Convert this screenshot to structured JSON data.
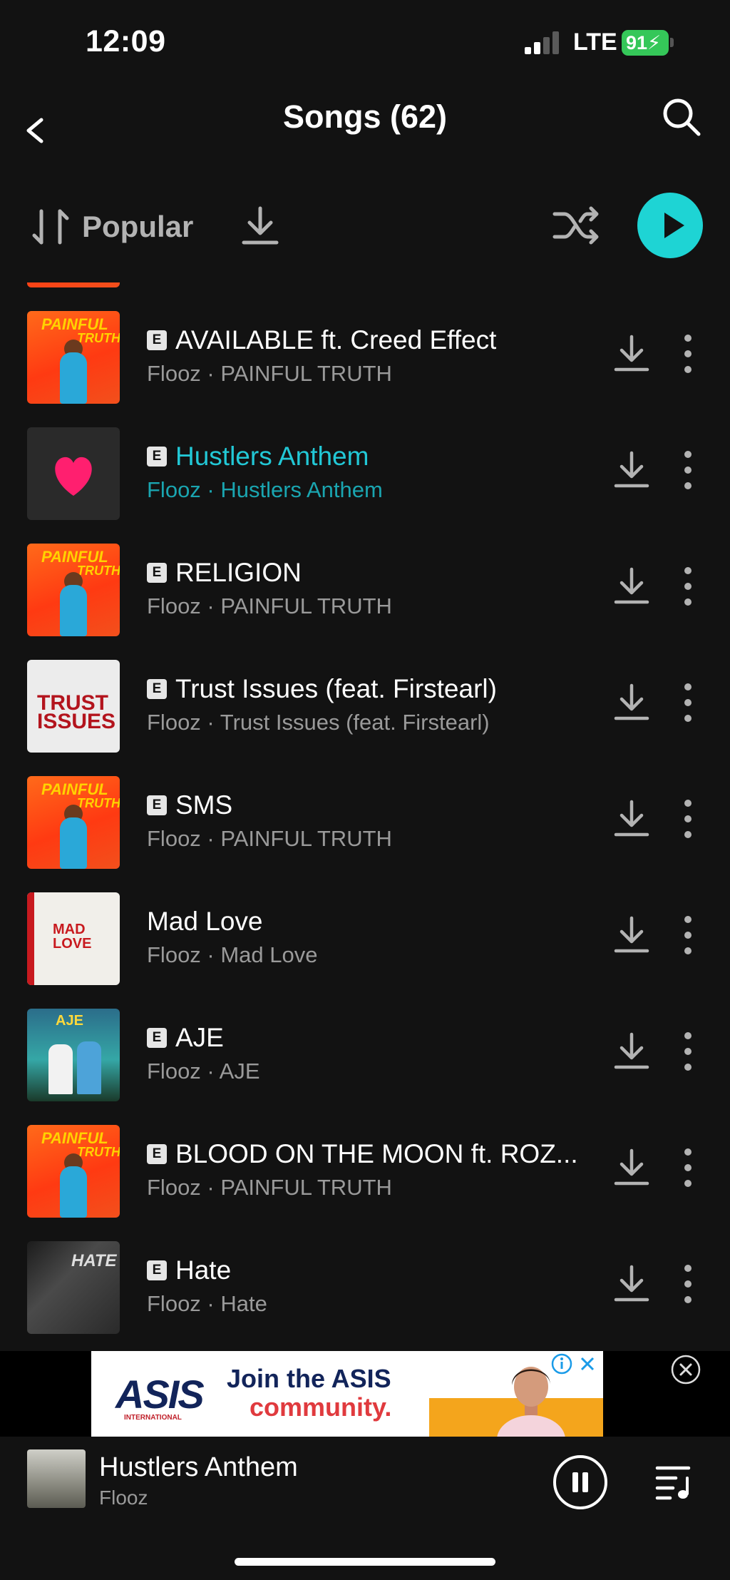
{
  "status": {
    "time": "12:09",
    "network": "LTE",
    "battery": "91"
  },
  "header": {
    "title": "Songs (62)",
    "back_icon": "chevron-left-icon",
    "search_icon": "search-icon"
  },
  "toolbar": {
    "sort_label": "Popular",
    "sort_icon": "sort-icon",
    "download_icon": "download-icon",
    "shuffle_icon": "shuffle-icon",
    "play_icon": "play-icon"
  },
  "colors": {
    "accent": "#1ed4d4",
    "active_text": "#22c8d6",
    "background": "#121212",
    "secondary_text": "#9a9a9a"
  },
  "songs": [
    {
      "title": "AVAILABLE ft. Creed Effect",
      "subtitle": "Flooz · PAINFUL TRUTH",
      "explicit": "E",
      "active": false
    },
    {
      "title": "Hustlers Anthem",
      "subtitle": "Flooz · Hustlers Anthem",
      "explicit": "E",
      "active": true
    },
    {
      "title": "RELIGION",
      "subtitle": "Flooz · PAINFUL TRUTH",
      "explicit": "E",
      "active": false
    },
    {
      "title": "Trust Issues (feat. Firstearl)",
      "subtitle": "Flooz · Trust Issues (feat. Firstearl)",
      "explicit": "E",
      "active": false
    },
    {
      "title": "SMS",
      "subtitle": "Flooz · PAINFUL TRUTH",
      "explicit": "E",
      "active": false
    },
    {
      "title": "Mad Love",
      "subtitle": "Flooz · Mad Love",
      "explicit": "",
      "active": false
    },
    {
      "title": "AJE",
      "subtitle": "Flooz · AJE",
      "explicit": "E",
      "active": false
    },
    {
      "title": "BLOOD ON THE MOON ft. ROZ...",
      "subtitle": "Flooz · PAINFUL TRUTH",
      "explicit": "E",
      "active": false
    },
    {
      "title": "Hate",
      "subtitle": "Flooz · Hate",
      "explicit": "E",
      "active": false
    }
  ],
  "album_art_text": {
    "painful_line1": "PAINFUL",
    "painful_line2": "TRUTH",
    "trust_line1": "TRUST",
    "trust_line2": "ISSUES",
    "mad_line1": "MAD",
    "mad_line2": "LOVE",
    "aje": "AJE",
    "hate": "HATE"
  },
  "ad": {
    "logo": "ASIS",
    "logo_sub": "INTERNATIONAL",
    "line1": "Join the ASIS",
    "line2": "community."
  },
  "player": {
    "title": "Hustlers Anthem",
    "artist": "Flooz",
    "pause_icon": "pause-icon",
    "queue_icon": "queue-icon"
  }
}
